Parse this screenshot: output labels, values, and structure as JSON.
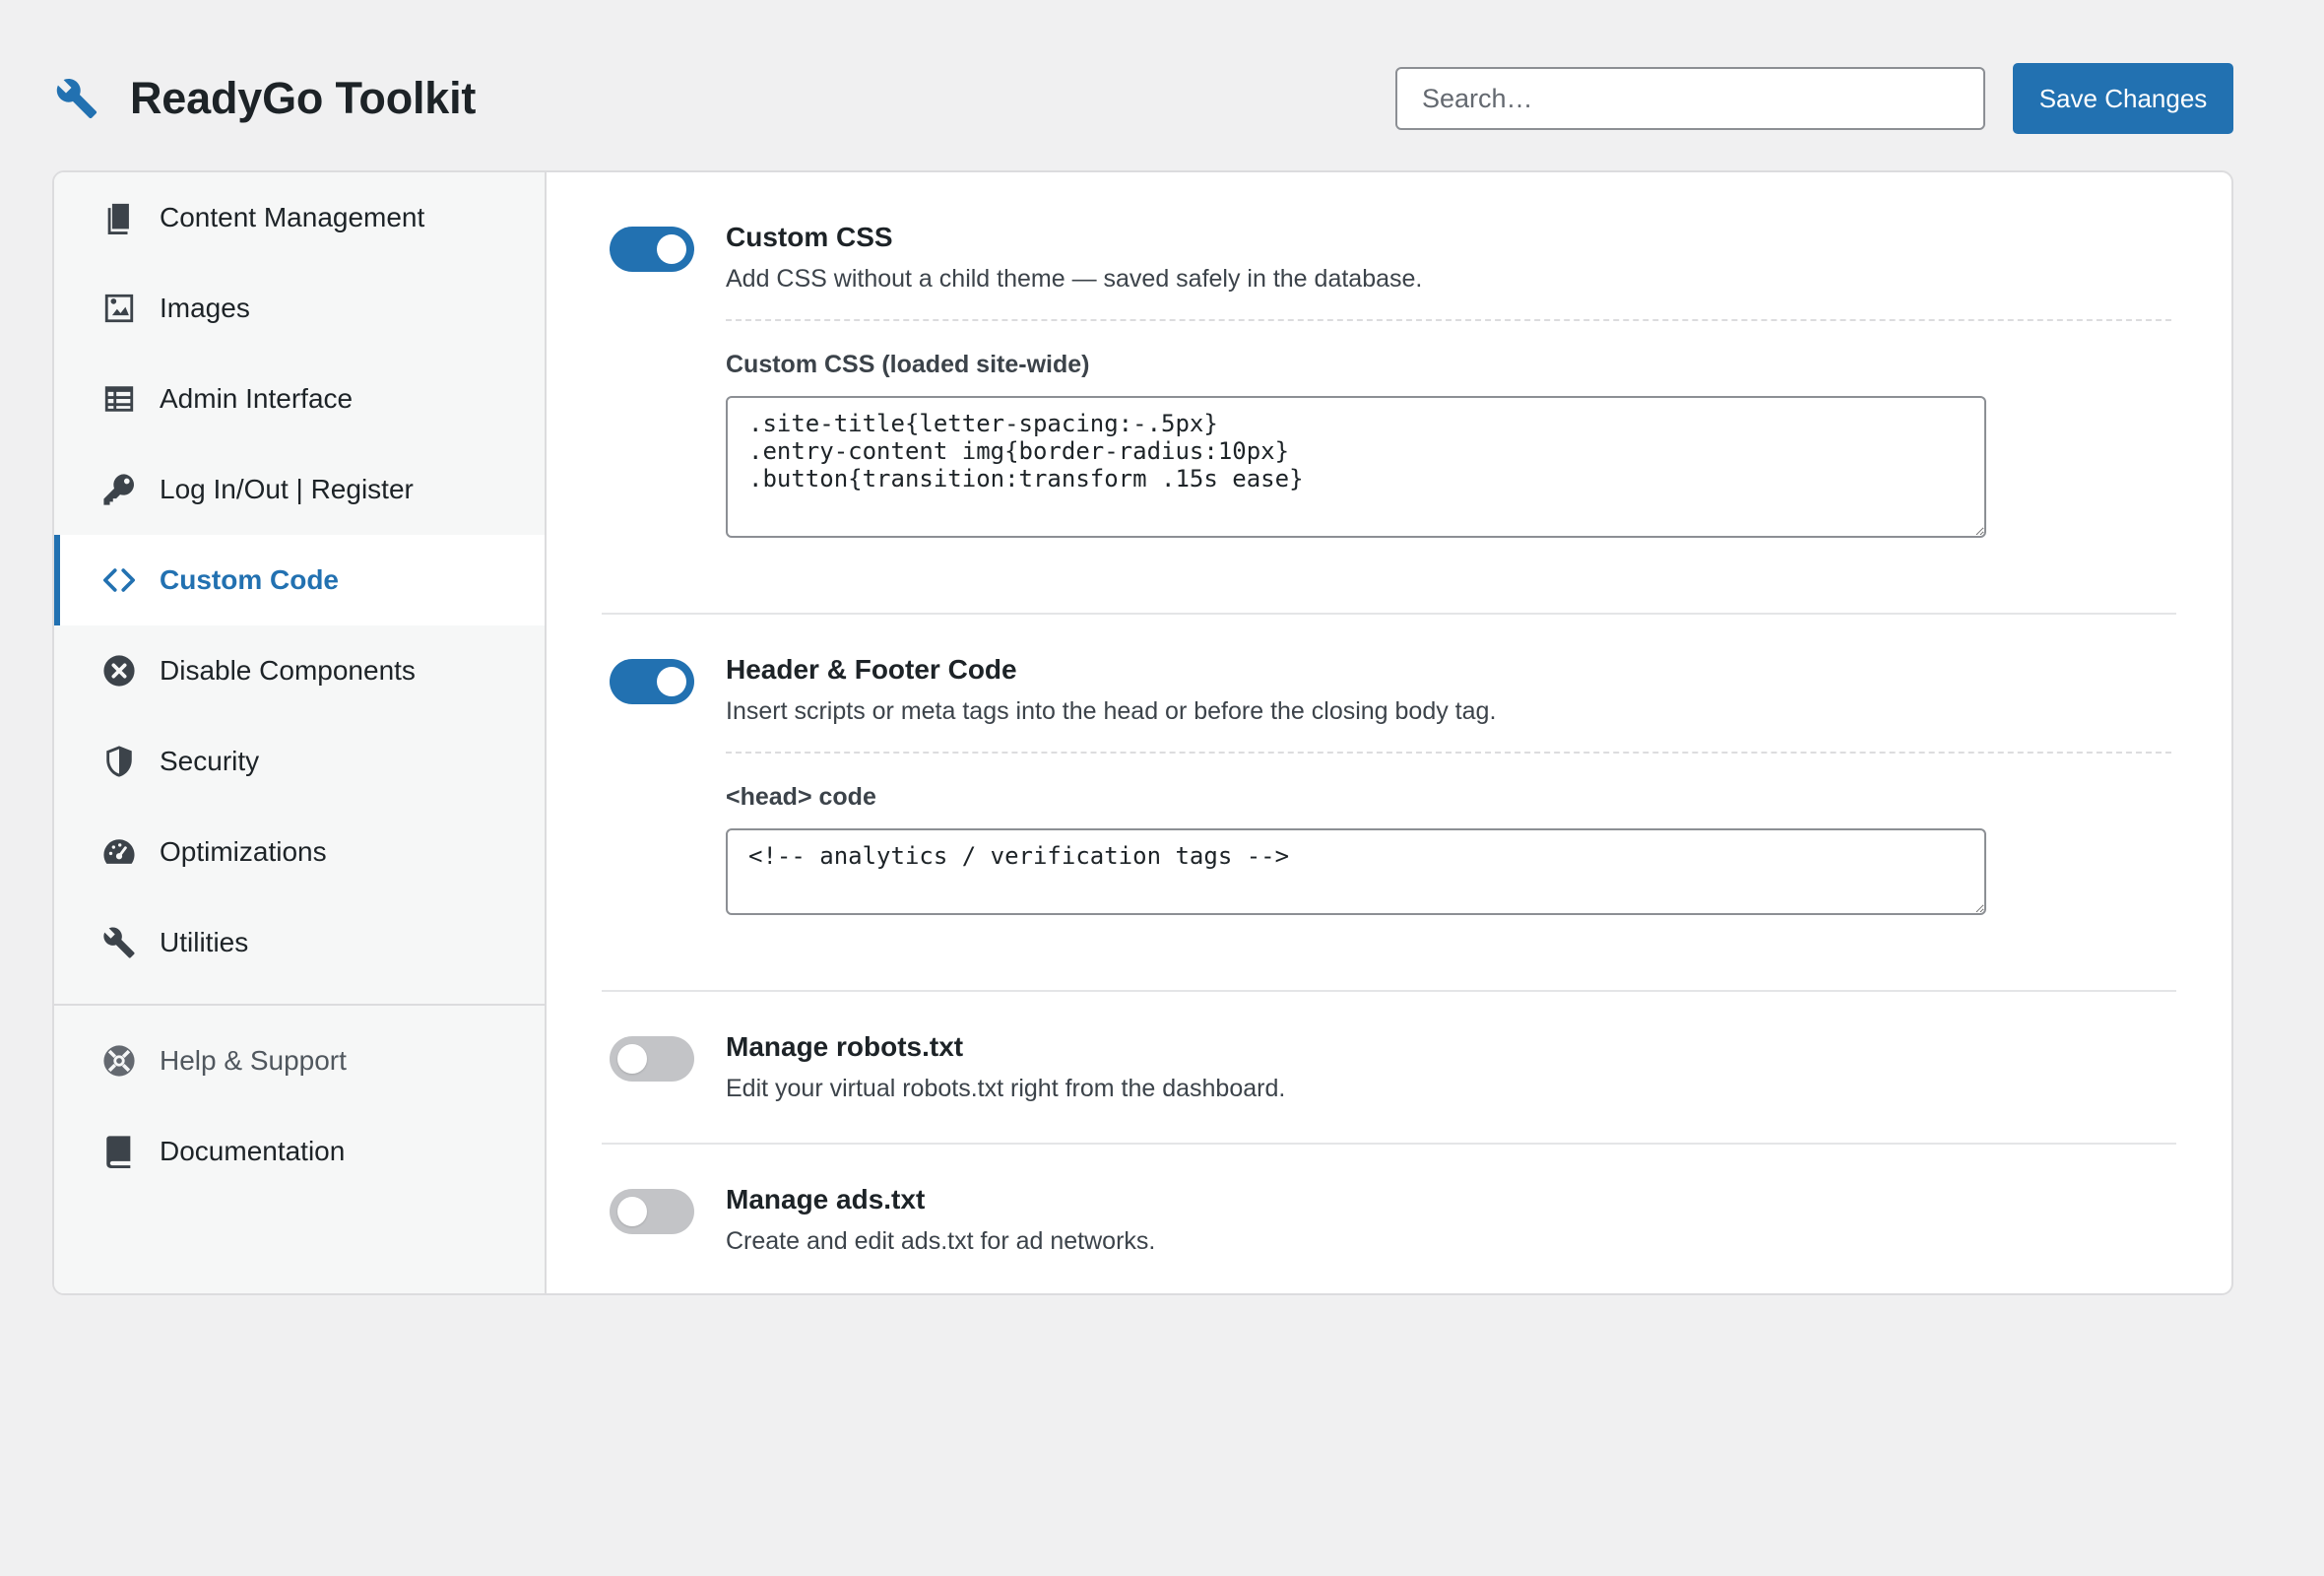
{
  "header": {
    "title": "ReadyGo Toolkit",
    "search_placeholder": "Search…",
    "save_label": "Save Changes",
    "accent_color": "#2271b1"
  },
  "sidebar": {
    "items": [
      {
        "label": "Content Management",
        "icon": "document-icon"
      },
      {
        "label": "Images",
        "icon": "image-icon"
      },
      {
        "label": "Admin Interface",
        "icon": "table-icon"
      },
      {
        "label": "Log In/Out | Register",
        "icon": "key-icon"
      },
      {
        "label": "Custom Code",
        "icon": "code-icon",
        "active": true
      },
      {
        "label": "Disable Components",
        "icon": "x-circle-icon"
      },
      {
        "label": "Security",
        "icon": "shield-icon"
      },
      {
        "label": "Optimizations",
        "icon": "dashboard-icon"
      },
      {
        "label": "Utilities",
        "icon": "wrench-icon"
      }
    ],
    "secondary": [
      {
        "label": "Help & Support",
        "icon": "lifebuoy-icon"
      },
      {
        "label": "Documentation",
        "icon": "book-icon"
      }
    ]
  },
  "settings": [
    {
      "title": "Custom CSS",
      "description": "Add CSS without a child theme — saved safely in the database.",
      "enabled": true,
      "field_label": "Custom CSS (loaded site-wide)",
      "field_value": ".site-title{letter-spacing:-.5px}\n.entry-content img{border-radius:10px}\n.button{transition:transform .15s ease}"
    },
    {
      "title": "Header & Footer Code",
      "description": "Insert scripts or meta tags into the head or before the closing body tag.",
      "enabled": true,
      "field_label": "<head> code",
      "field_value": "<!-- analytics / verification tags -->"
    },
    {
      "title": "Manage robots.txt",
      "description": "Edit your virtual robots.txt right from the dashboard.",
      "enabled": false
    },
    {
      "title": "Manage ads.txt",
      "description": "Create and edit ads.txt for ad networks.",
      "enabled": false
    }
  ]
}
